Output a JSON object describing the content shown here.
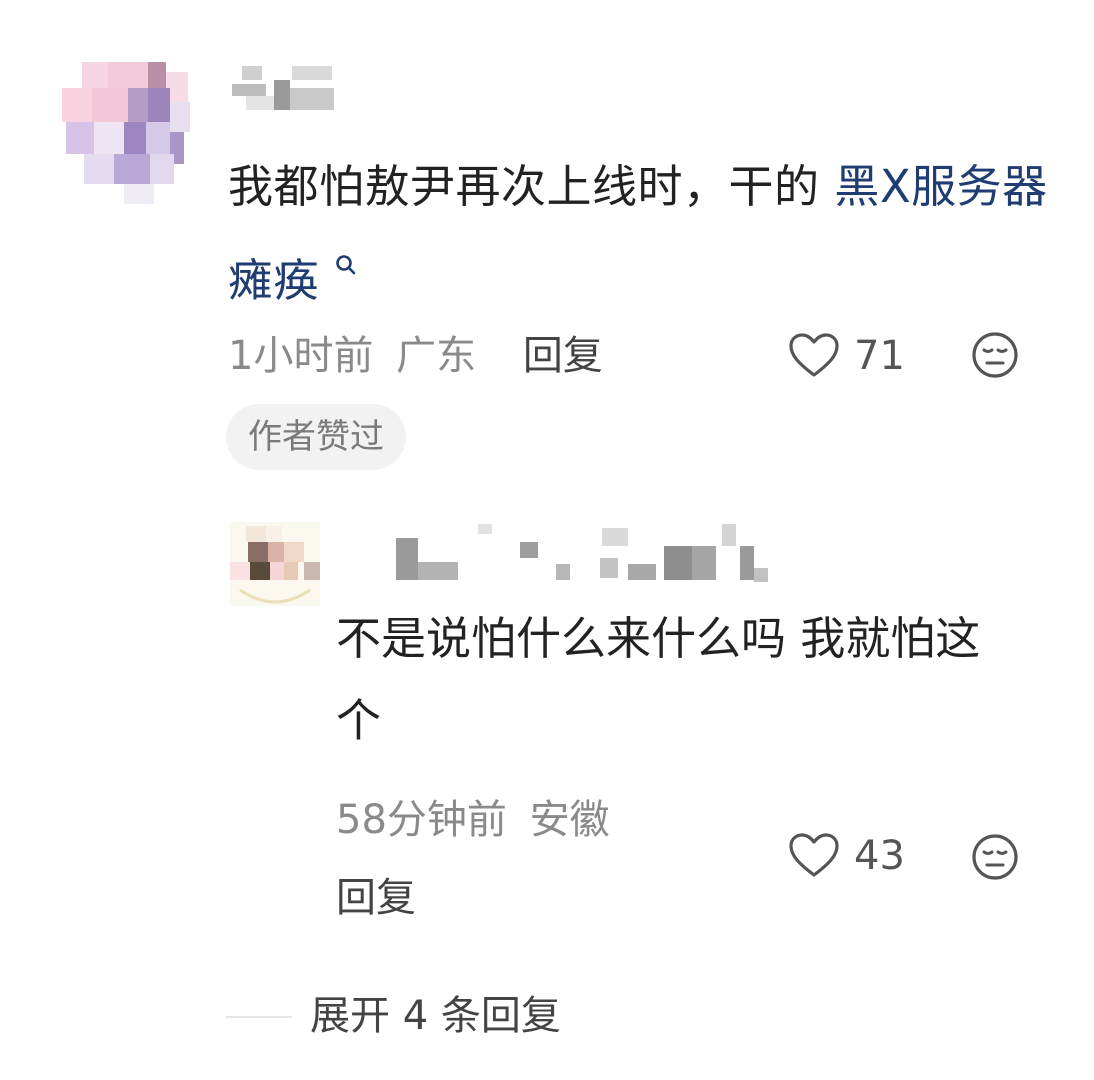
{
  "comment": {
    "text": "我都怕敖尹再次上线时，干的 ",
    "link": "黑X服务器瘫痪",
    "link_icon": "search-icon",
    "time": "1小时前",
    "location": "广东",
    "reply_label": "回复",
    "likes": "71",
    "author_badge": "作者赞过"
  },
  "reply": {
    "text": "不是说怕什么来什么吗 我就怕这个",
    "time": "58分钟前",
    "location": "安徽",
    "reply_label": "回复",
    "likes": "43"
  },
  "expand_label": "展开 4 条回复",
  "colors": {
    "link": "#1f3d72",
    "meta": "#8a8a8a",
    "badge_bg": "#f2f2f2"
  }
}
